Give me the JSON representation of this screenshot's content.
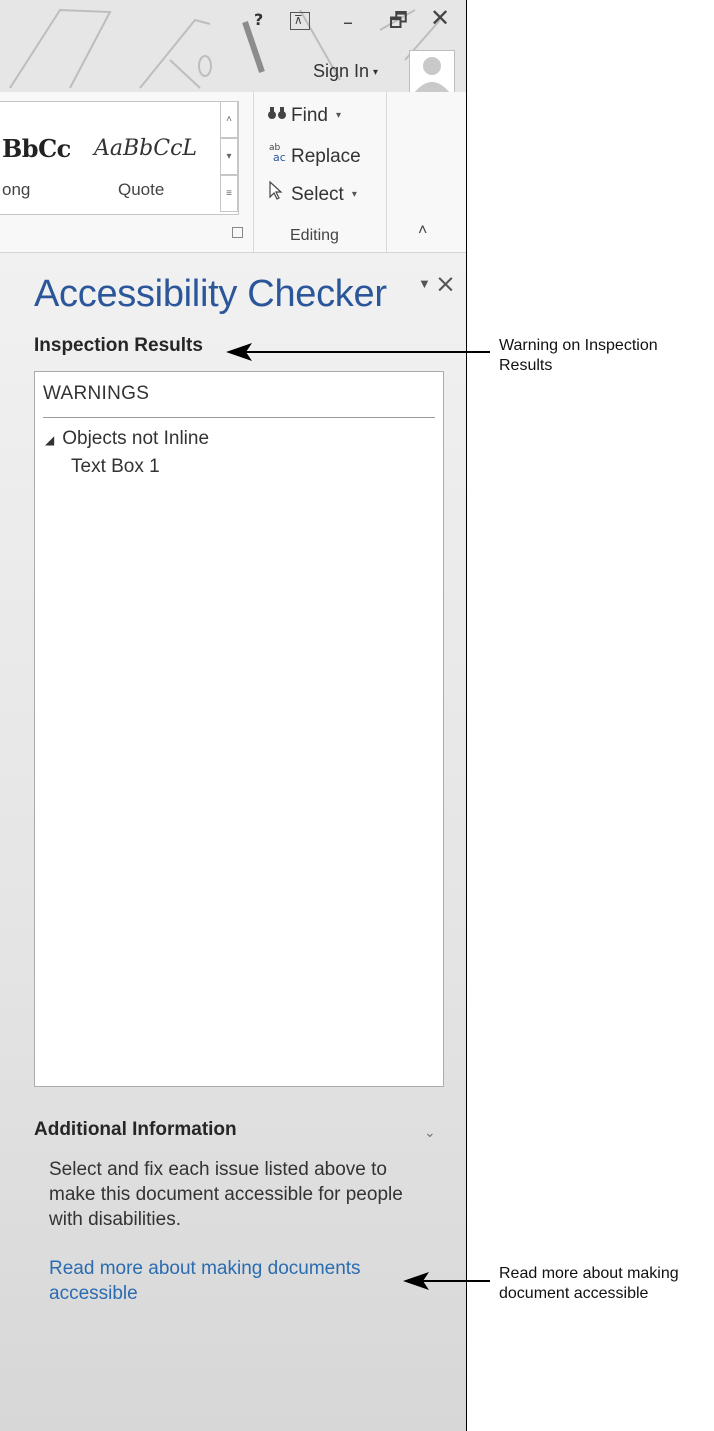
{
  "titlebar": {
    "help_label": "?",
    "ribbon_options_label": "⊼",
    "minimize_label": "–",
    "restore_label": "🗗",
    "close_label": "✕",
    "sign_in_label": "Sign In",
    "sign_in_caret": "▾"
  },
  "ribbon": {
    "styles": {
      "preview_1": "BbCc",
      "preview_2": "AaBbCcL",
      "name_1": "ong",
      "name_2": "Quote"
    },
    "editing": {
      "find_label": "Find",
      "replace_label": "Replace",
      "select_label": "Select",
      "group_label": "Editing"
    }
  },
  "pane": {
    "title": "Accessibility Checker",
    "inspection_results_heading": "Inspection Results",
    "warnings_heading": "WARNINGS",
    "tree": {
      "category": "Objects not Inline",
      "item": "Text Box 1"
    },
    "additional_info_heading": "Additional Information",
    "info_text": "Select and fix each issue listed above to make this document accessible for people with disabilities.",
    "info_link": "Read more about making documents accessible"
  },
  "callouts": {
    "warning": "Warning on Inspection Results",
    "read_more": "Read more about making document accessible"
  },
  "colors": {
    "accent": "#2b579a",
    "link": "#2b6cb0"
  }
}
